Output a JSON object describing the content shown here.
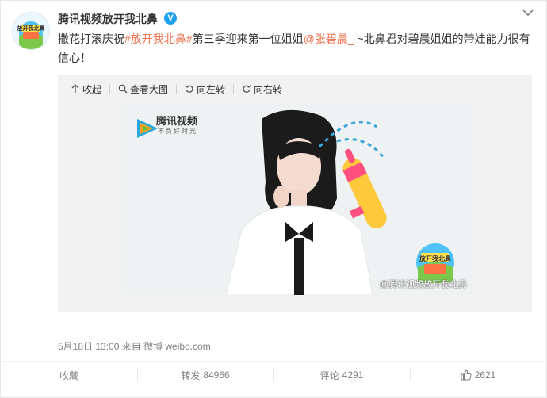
{
  "post": {
    "author": "腾讯视频放开我北鼻",
    "verified_mark": "V",
    "avatar_text": "放开我北鼻",
    "text": {
      "part1": "撒花打滚庆祝",
      "hashtag": "#放开我北鼻#",
      "part2": "第三季迎来第一位姐姐",
      "mention": "@张碧晨_",
      "part3": " ~北鼻君对碧晨姐姐的带娃能力很有信心！"
    },
    "meta": "5月18日 13:00 来自 微博 weibo.com"
  },
  "media_toolbar": {
    "collapse": "收起",
    "view_large": "查看大图",
    "rotate_left": "向左转",
    "rotate_right": "向右转"
  },
  "photo": {
    "logo_title": "腾讯视频",
    "logo_subtitle": "不负好时光",
    "badge_text": "放开我北鼻",
    "watermark": "@腾讯视频放开我北鼻"
  },
  "footer": {
    "favorite": "收藏",
    "repost_label": "转发",
    "repost_count": "84966",
    "comment_label": "评论",
    "comment_count": "4291",
    "like_count": "2621"
  },
  "colors": {
    "link": "#eb7350",
    "verified": "#1da1f2",
    "meta": "#808080"
  }
}
